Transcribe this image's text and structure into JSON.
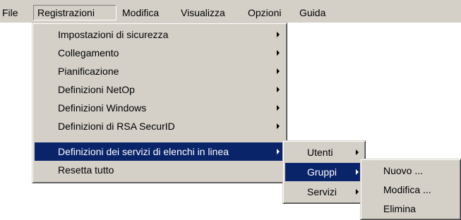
{
  "menubar": {
    "items": [
      {
        "label": "File"
      },
      {
        "label": "Registrazioni"
      },
      {
        "label": "Modifica"
      },
      {
        "label": "Visualizza"
      },
      {
        "label": "Opzioni"
      },
      {
        "label": "Guida"
      }
    ]
  },
  "registrazioni_menu": {
    "items": [
      {
        "label": "Impostazioni di sicurezza",
        "has_submenu": true
      },
      {
        "label": "Collegamento",
        "has_submenu": true
      },
      {
        "label": "Pianificazione",
        "has_submenu": true
      },
      {
        "label": "Definizioni NetOp",
        "has_submenu": true
      },
      {
        "label": "Definizioni Windows",
        "has_submenu": true
      },
      {
        "label": "Definizioni di RSA SecurID",
        "has_submenu": true
      },
      {
        "label": "Definizioni dei servizi di elenchi in linea",
        "has_submenu": true,
        "highlighted": true
      },
      {
        "label": "Resetta tutto",
        "has_submenu": false
      }
    ]
  },
  "directory_submenu": {
    "items": [
      {
        "label": "Utenti",
        "has_submenu": true
      },
      {
        "label": "Gruppi",
        "has_submenu": true,
        "highlighted": true
      },
      {
        "label": "Servizi",
        "has_submenu": true
      }
    ]
  },
  "gruppi_submenu": {
    "items": [
      {
        "label": "Nuovo ..."
      },
      {
        "label": "Modifica ..."
      },
      {
        "label": "Elimina"
      }
    ]
  },
  "colors": {
    "menu_face": "#d4d0c8",
    "highlight": "#0a246a",
    "highlight_text": "#ffffff"
  }
}
